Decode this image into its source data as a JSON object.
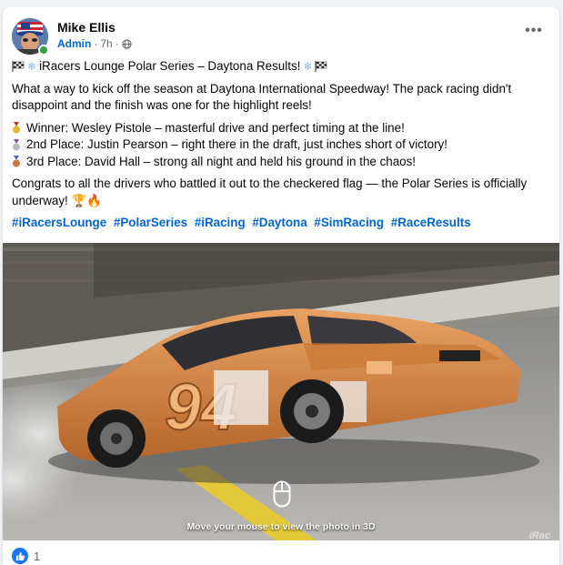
{
  "post": {
    "author": "Mike Ellis",
    "role": "Admin",
    "separator1": "·",
    "time": "7h",
    "separator2": "·",
    "more_label": "•••",
    "title": "iRacers Lounge Polar Series – Daytona Results!",
    "intro": "What a way to kick off the season at Daytona International Speedway! The pack racing didn't disappoint and the finish was one for the highlight reels!",
    "results": [
      {
        "medal": "gold",
        "text": "Winner: Wesley Pistole – masterful drive and perfect timing at the line!"
      },
      {
        "medal": "silver",
        "text": "2nd Place: Justin Pearson – right there in the draft, just inches short of victory!"
      },
      {
        "medal": "bronze",
        "text": "3rd Place: David Hall – strong all night and held his ground in the chaos!"
      }
    ],
    "outro": "Congrats to all the drivers who battled it out to the checkered flag — the Polar Series is officially underway!",
    "hashtags": [
      "#iRacersLounge",
      "#PolarSeries",
      "#iRacing",
      "#Daytona",
      "#SimRacing",
      "#RaceResults"
    ]
  },
  "photo": {
    "car_number": "94",
    "hint": "Move your mouse to view the photo in 3D",
    "watermark": "iRac",
    "mouse_icon": "mouse-icon"
  },
  "reactions": {
    "icon": "like-icon",
    "count": "1"
  },
  "colors": {
    "link": "#0064d1",
    "like": "#1877f2",
    "car": "#d9843e",
    "online": "#31a24c"
  }
}
